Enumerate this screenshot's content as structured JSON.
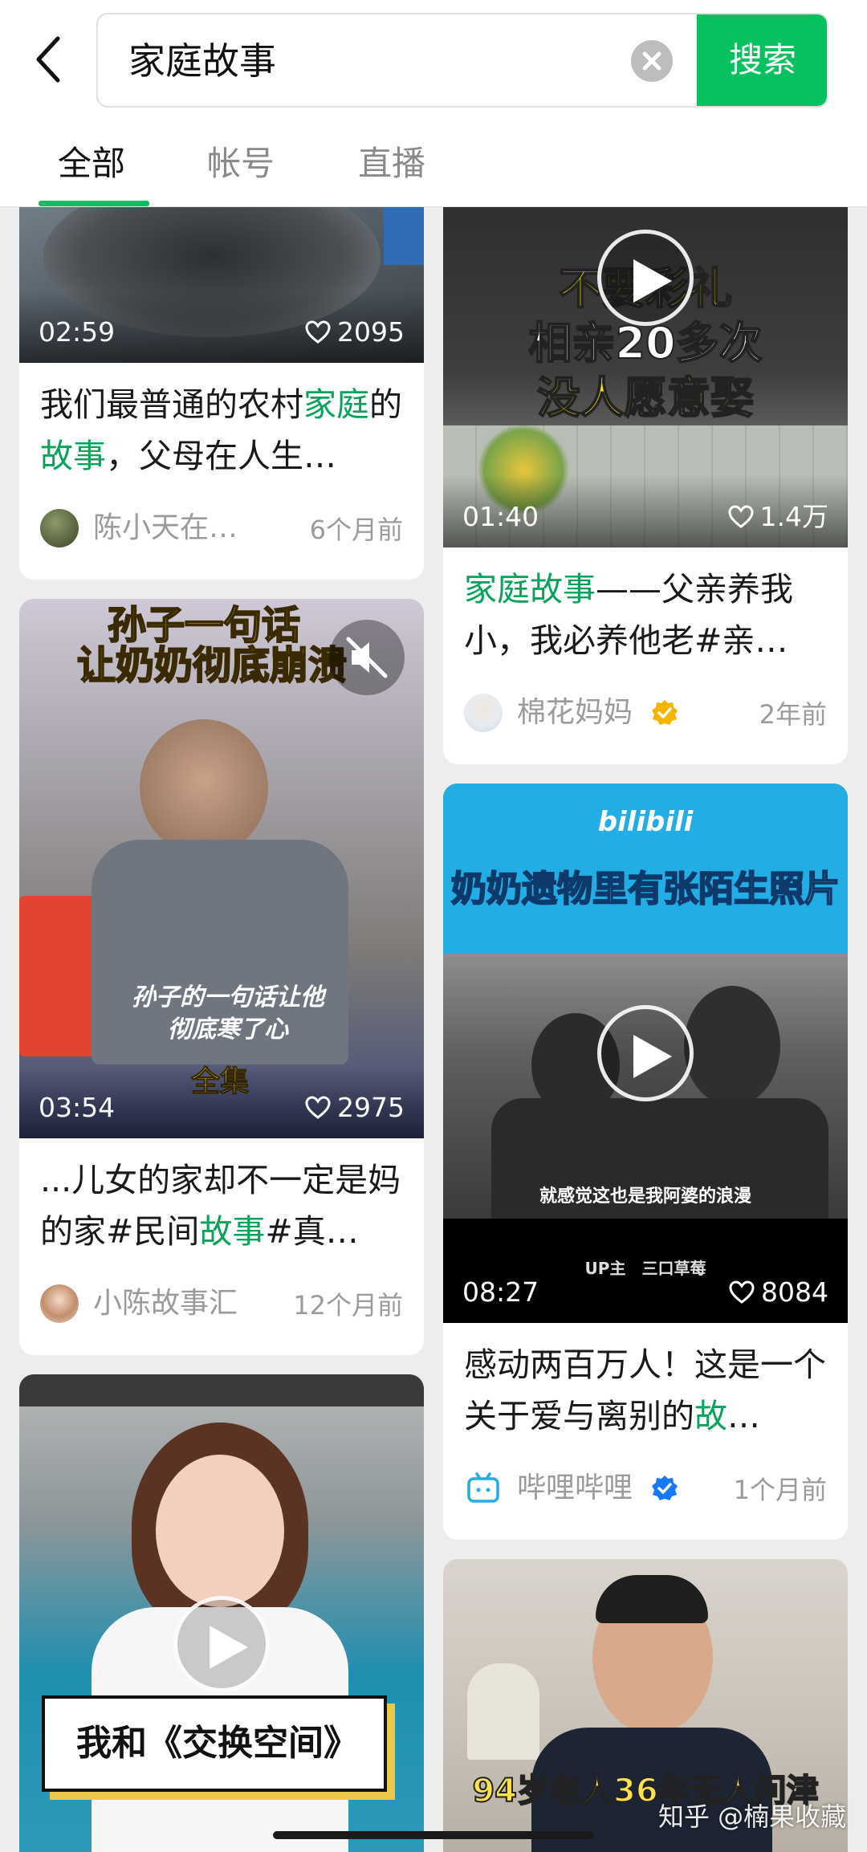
{
  "search": {
    "query": "家庭故事",
    "button_label": "搜索"
  },
  "tabs": [
    "全部",
    "帐号",
    "直播"
  ],
  "cards": [
    {
      "duration": "02:59",
      "likes": "2095",
      "title_parts": [
        "我们最普通的农村",
        "家庭",
        "的",
        "故事",
        "，父母在人生…"
      ],
      "author": "陈小天在…",
      "time": "6个月前"
    },
    {
      "duration": "01:40",
      "likes": "1.4万",
      "overlay_lines": [
        "不要彩礼",
        "相亲20多次",
        "没人愿意娶"
      ],
      "title_parts": [
        "家庭故事",
        "——父亲养我小，我必养他老#亲…"
      ],
      "author": "棉花妈妈",
      "time": "2年前"
    },
    {
      "duration": "03:54",
      "likes": "2975",
      "overlay_top": [
        "孙子一句话",
        "让奶奶彻底崩溃"
      ],
      "overlay_caption": [
        "孙子的一句话让他",
        "彻底寒了心"
      ],
      "overlay_badge": "全集",
      "title_parts": [
        "...儿女的家却不一定是妈的家#民间",
        "故事",
        "#真…"
      ],
      "author": "小陈故事汇",
      "time": "12个月前"
    },
    {
      "duration": "08:27",
      "likes": "8084",
      "brand": "bilibili",
      "banner": "奶奶遗物里有张陌生照片",
      "subtitle": "就感觉这也是我阿婆的浪漫",
      "uploader": "UP主　三口草莓",
      "title_parts": [
        "感动两百万人！这是一个关于爱与离别的",
        "故",
        "…"
      ],
      "author": "哔哩哔哩",
      "time": "1个月前"
    },
    {
      "overlay_title": "我和《交换空间》"
    },
    {
      "overlay_title": "94岁老人36年无人问津"
    }
  ],
  "watermark": "知乎 @楠果收藏",
  "colors": {
    "accent": "#07c160",
    "highlight": "#07a35a",
    "verified_gold": "#f5b400",
    "verified_blue": "#1677ff",
    "bilibili_blue": "#23ade5"
  }
}
